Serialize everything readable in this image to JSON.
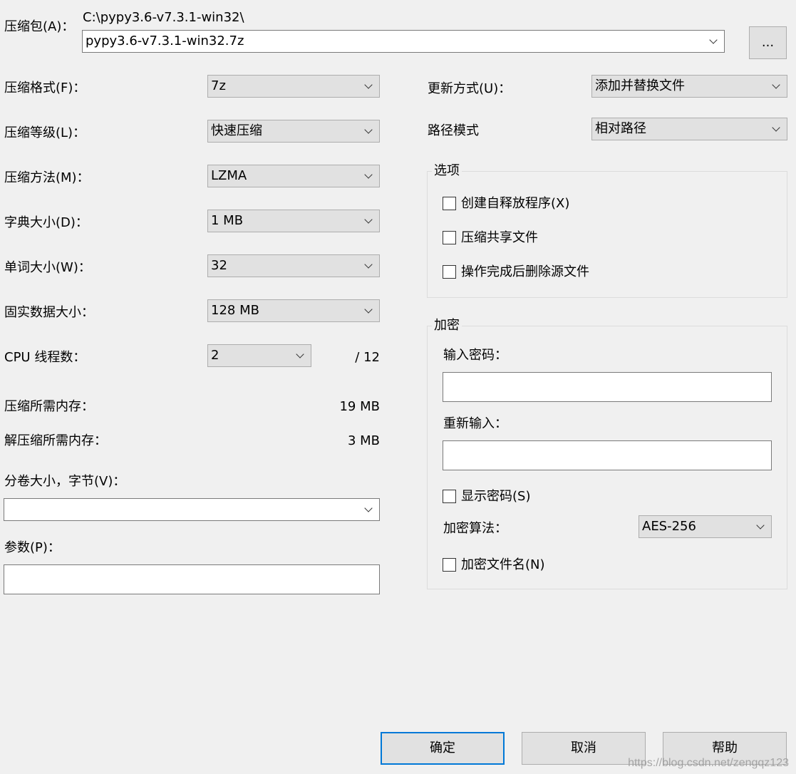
{
  "archive": {
    "label": "压缩包(A)：",
    "path": "C:\\pypy3.6-v7.3.1-win32\\",
    "filename": "pypy3.6-v7.3.1-win32.7z",
    "browse_label": "..."
  },
  "left": {
    "format": {
      "label": "压缩格式(F)：",
      "value": "7z"
    },
    "level": {
      "label": "压缩等级(L)：",
      "value": "快速压缩"
    },
    "method": {
      "label": "压缩方法(M)：",
      "value": "LZMA"
    },
    "dict": {
      "label": "字典大小(D)：",
      "value": "1 MB"
    },
    "word": {
      "label": "单词大小(W)：",
      "value": "32"
    },
    "solid": {
      "label": "固实数据大小：",
      "value": "128 MB"
    },
    "threads": {
      "label": "CPU 线程数：",
      "value": "2",
      "max": "/ 12"
    },
    "mem_compress": {
      "label": "压缩所需内存：",
      "value": "19 MB"
    },
    "mem_decompress": {
      "label": "解压缩所需内存：",
      "value": "3 MB"
    },
    "volume": {
      "label": "分卷大小，字节(V)：",
      "value": ""
    },
    "params": {
      "label": "参数(P)：",
      "value": ""
    }
  },
  "right": {
    "update": {
      "label": "更新方式(U)：",
      "value": "添加并替换文件"
    },
    "pathmode": {
      "label": "路径模式",
      "value": "相对路径"
    },
    "options": {
      "title": "选项",
      "sfx": "创建自释放程序(X)",
      "shared": "压缩共享文件",
      "delete": "操作完成后删除源文件"
    },
    "encryption": {
      "title": "加密",
      "password_label": "输入密码：",
      "reenter_label": "重新输入：",
      "show_password": "显示密码(S)",
      "method_label": "加密算法：",
      "method_value": "AES-256",
      "encrypt_names": "加密文件名(N)"
    }
  },
  "buttons": {
    "ok": "确定",
    "cancel": "取消",
    "help": "帮助"
  },
  "watermark": "https://blog.csdn.net/zengqz123",
  "colors": {
    "background": "#f0f0f0",
    "focus_border": "#0078d7",
    "combo_bg": "#e1e1e1"
  }
}
